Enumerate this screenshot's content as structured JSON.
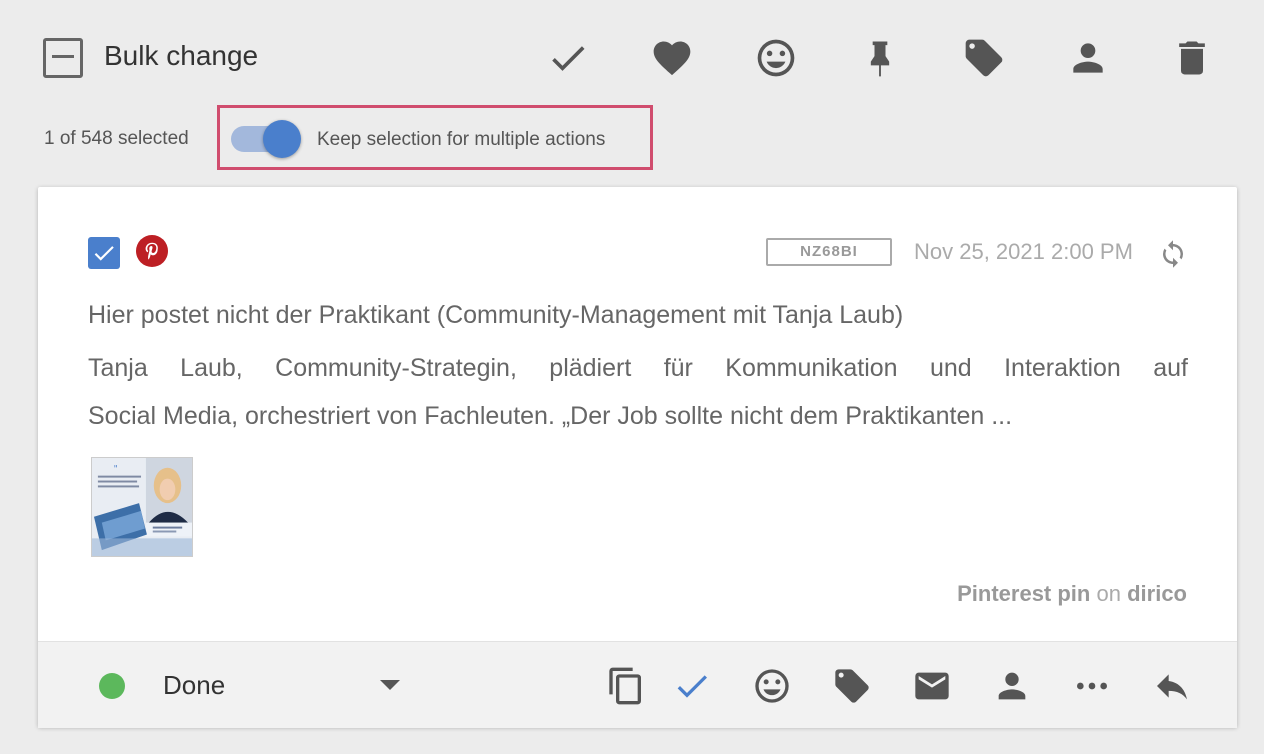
{
  "toolbar": {
    "title": "Bulk change",
    "icons": [
      "check-icon",
      "heart-icon",
      "smiley-icon",
      "pin-icon",
      "tag-icon",
      "person-icon",
      "trash-icon"
    ]
  },
  "selection": {
    "count_text": "1 of 548 selected",
    "keep_label": "Keep selection for multiple actions",
    "keep_enabled": true
  },
  "post": {
    "id": "NZ68BI",
    "date": "Nov 25, 2021 2:00 PM",
    "title": "Hier postet nicht der Praktikant (Community-Management mit Tanja Laub)",
    "body_line1": "Tanja Laub, Community-Strategin, plädiert für Kommunikation und Interaktion auf",
    "body_line2": "Social Media, orchestriert von Fachleuten. „Der Job sollte nicht dem Praktikanten ...",
    "source_type": "Pinterest pin",
    "source_connector": "on",
    "source_account": "dirico",
    "checked": true
  },
  "footer": {
    "status": "Done",
    "status_color": "#5cb85c",
    "icons": [
      "copy-icon",
      "check-icon",
      "smiley-icon",
      "tag-icon",
      "mail-icon",
      "person-icon",
      "more-icon",
      "reply-icon"
    ]
  },
  "colors": {
    "accent": "#4a7fcc",
    "highlight": "#d04d6e",
    "pinterest": "#bd1f24"
  }
}
